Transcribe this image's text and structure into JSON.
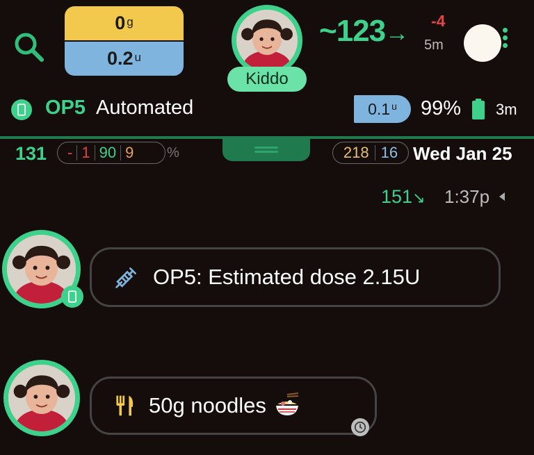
{
  "header": {
    "search_icon": "search-icon",
    "carbs": {
      "value": "0",
      "unit": "g"
    },
    "insulin": {
      "value": "0.2",
      "unit": "u"
    },
    "profile_name": "Kiddo",
    "bg": {
      "value": "~123",
      "trend_arrow": "→",
      "delta": "-4",
      "age": "5m"
    },
    "menu_icon": "more-vertical-icon"
  },
  "status": {
    "pump_name": "OP5",
    "pump_mode": "Automated",
    "basal": {
      "value": "0.1",
      "unit": "u"
    },
    "battery_pct": "99%",
    "battery_age": "3m"
  },
  "stats": {
    "avg_bg": "131",
    "tir": {
      "low": "-",
      "very_low": "1",
      "in_range": "90",
      "high": "9"
    },
    "tir_unit": "%",
    "totals": {
      "carbs": "218",
      "insulin": "16"
    },
    "date": "Wed Jan 25"
  },
  "latest_entry": {
    "bg": "151",
    "trend_arrow": "↘",
    "time": "1:37p"
  },
  "feed": [
    {
      "text": "OP5: Estimated dose 2.15U",
      "icon": "syringe-icon"
    },
    {
      "text": "50g noodles",
      "icon": "fork-knife-icon",
      "emoji": "noodle-bowl-icon"
    }
  ],
  "colors": {
    "background": "#150d0c",
    "accent_green": "#3dd18c",
    "carbs_yellow": "#f2c94c",
    "insulin_blue": "#7fb4de",
    "delta_red": "#e04545"
  }
}
